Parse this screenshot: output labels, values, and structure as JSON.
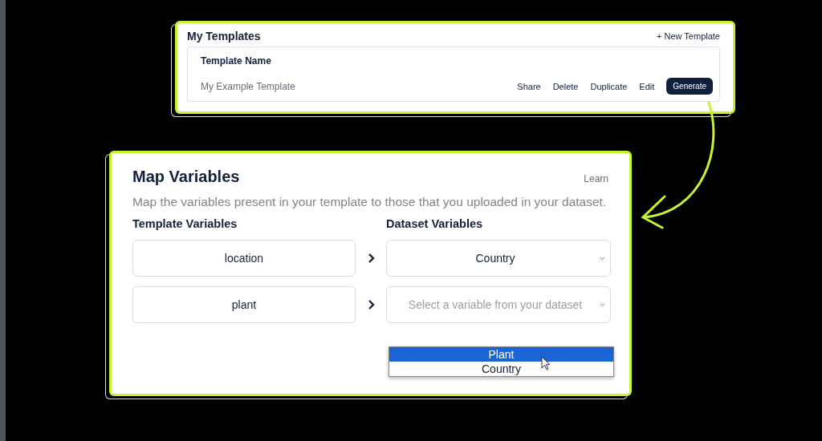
{
  "templates": {
    "title": "My Templates",
    "new_button": "+ New Template",
    "column_header": "Template Name",
    "rows": [
      {
        "name": "My Example Template",
        "actions": [
          "Share",
          "Delete",
          "Duplicate",
          "Edit"
        ],
        "primary_action": "Generate"
      }
    ]
  },
  "map_variables": {
    "title": "Map Variables",
    "learn": "Learn",
    "description": "Map the variables present in your template to those that you uploaded in your dataset.",
    "template_header": "Template Variables",
    "dataset_header": "Dataset Variables",
    "mappings": [
      {
        "template_variable": "location",
        "dataset_value": "Country"
      },
      {
        "template_variable": "plant",
        "placeholder": "Select a variable from your dataset"
      }
    ],
    "dropdown_options": [
      {
        "label": "Plant",
        "selected": true
      },
      {
        "label": "Country",
        "selected": false
      }
    ]
  }
}
